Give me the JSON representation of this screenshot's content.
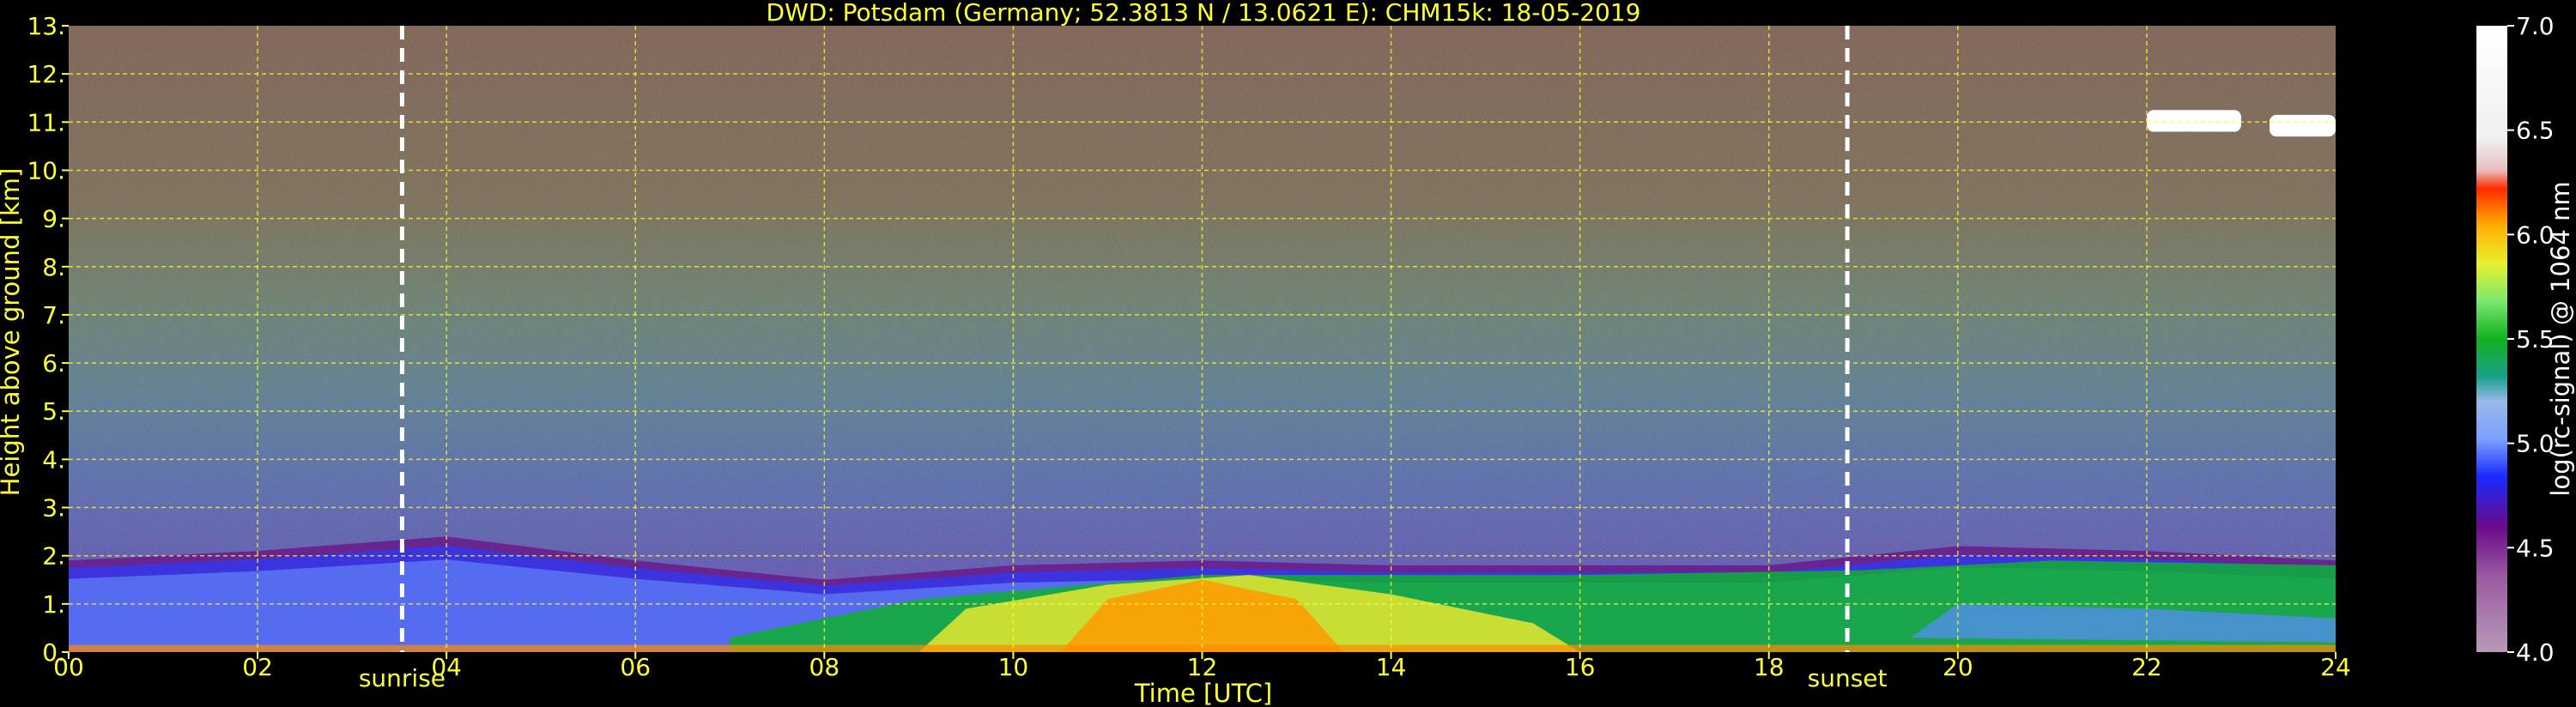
{
  "chart_data": {
    "type": "heatmap",
    "title": "DWD: Potsdam (Germany; 52.3813 N / 13.0621 E):    CHM15k: 18-05-2019",
    "xlabel": "Time [UTC]",
    "ylabel": "Height above ground [km]",
    "xlim": [
      0,
      24
    ],
    "ylim": [
      0,
      13
    ],
    "x_ticks": [
      "00",
      "02",
      "04",
      "06",
      "08",
      "10",
      "12",
      "14",
      "16",
      "18",
      "20",
      "22",
      "24"
    ],
    "y_ticks": [
      "0.",
      "1.",
      "2.",
      "3.",
      "4.",
      "5.",
      "6.",
      "7.",
      "8.",
      "9.",
      "10.",
      "11.",
      "12.",
      "13."
    ],
    "grid": true,
    "events": [
      {
        "label": "sunrise",
        "time": 3.53
      },
      {
        "label": "sunset",
        "time": 18.83
      }
    ],
    "colorbar": {
      "label": "log(rc-signal) @ 1064 nm",
      "range": [
        4.0,
        7.0
      ],
      "ticks": [
        "4.0",
        "4.5",
        "5.0",
        "5.5",
        "6.0",
        "6.5",
        "7.0"
      ]
    },
    "boundary_layer_top_km": [
      {
        "time": 0,
        "height": 1.9
      },
      {
        "time": 2,
        "height": 2.1
      },
      {
        "time": 4,
        "height": 2.4
      },
      {
        "time": 6,
        "height": 1.9
      },
      {
        "time": 8,
        "height": 1.5
      },
      {
        "time": 10,
        "height": 1.8
      },
      {
        "time": 12,
        "height": 1.9
      },
      {
        "time": 14,
        "height": 1.8
      },
      {
        "time": 16,
        "height": 1.8
      },
      {
        "time": 18,
        "height": 1.8
      },
      {
        "time": 20,
        "height": 2.2
      },
      {
        "time": 22,
        "height": 2.1
      },
      {
        "time": 24,
        "height": 1.9
      }
    ],
    "cloud_layers": [
      {
        "time_start": 22.0,
        "time_end": 23.0,
        "height": 11.0
      },
      {
        "time_start": 23.3,
        "time_end": 24.0,
        "height": 10.9
      }
    ]
  }
}
